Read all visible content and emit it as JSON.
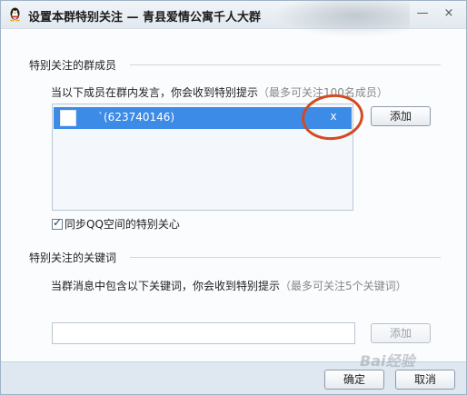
{
  "window": {
    "title": "设置本群特别关注 — 青县爱情公寓千人大群",
    "minimize_glyph": "—",
    "close_glyph": "×"
  },
  "members_section": {
    "label": "特别关注的群成员",
    "description": "当以下成员在群内发言，你会收到特别提示",
    "hint": "（最多可关注100名成员）",
    "items": [
      {
        "name": "`(623740146)",
        "remove_label": "x"
      }
    ],
    "add_label": "添加",
    "sync_checked": true,
    "sync_label": "同步QQ空间的特别关心"
  },
  "keywords_section": {
    "label": "特别关注的关键词",
    "description": "当群消息中包含以下关键词，你会收到特别提示",
    "hint": "（最多可关注5个关键词）",
    "input_value": "",
    "add_label": "添加"
  },
  "footer": {
    "ok_label": "确定",
    "cancel_label": "取消"
  },
  "colors": {
    "selection": "#3c8be6",
    "annotation_circle": "#d44a1e"
  }
}
